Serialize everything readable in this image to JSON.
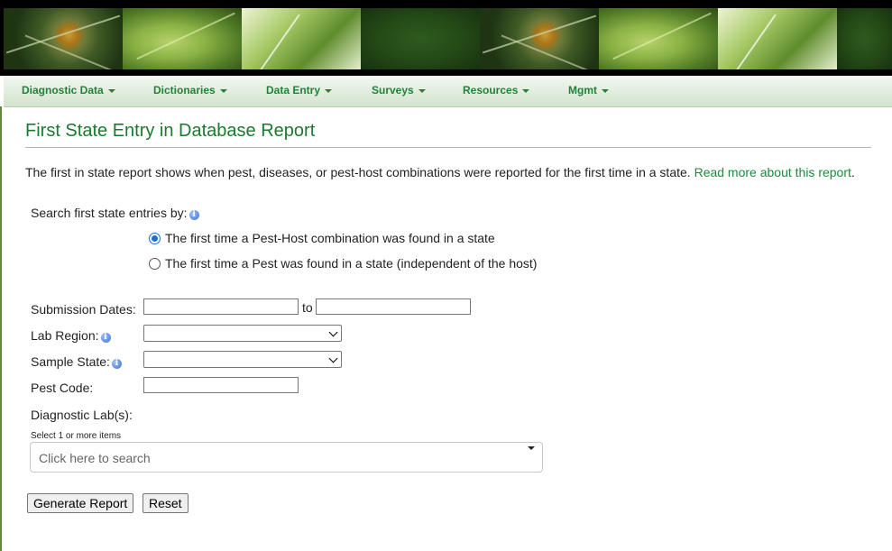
{
  "nav": {
    "items": [
      {
        "label": "Diagnostic Data"
      },
      {
        "label": "Dictionaries"
      },
      {
        "label": "Data Entry"
      },
      {
        "label": "Surveys"
      },
      {
        "label": "Resources"
      },
      {
        "label": "Mgmt"
      }
    ]
  },
  "page": {
    "title": "First State Entry in Database Report",
    "intro_text": "The first in state report shows when pest, diseases, or pest-host combinations were reported for the first time in a state.",
    "read_more_link": "Read more about this report",
    "intro_end": "."
  },
  "search_by": {
    "label": "Search first state entries by:",
    "options": [
      {
        "label": "The first time a Pest-Host combination was found in a state",
        "checked": true
      },
      {
        "label": "The first time a Pest was found in a state (independent of the host)",
        "checked": false
      }
    ]
  },
  "form": {
    "submission_dates_label": "Submission Dates:",
    "to_label": "to",
    "date_from": "",
    "date_to": "",
    "lab_region_label": "Lab Region:",
    "lab_region_value": "",
    "sample_state_label": "Sample State:",
    "sample_state_value": "",
    "pest_code_label": "Pest Code:",
    "pest_code_value": "",
    "diagnostic_labs_label": "Diagnostic Lab(s):",
    "select_hint": "Select 1 or more items",
    "search_placeholder": "Click here to search"
  },
  "buttons": {
    "generate": "Generate Report",
    "reset": "Reset"
  },
  "icons": {
    "info": "i"
  },
  "colors": {
    "title_green": "#1b7a2e",
    "nav_green": "#21823a",
    "link_green": "#1d8a3a"
  }
}
